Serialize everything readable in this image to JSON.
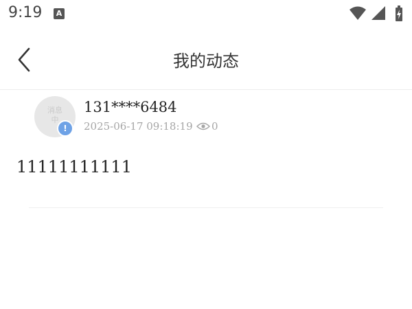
{
  "status_bar": {
    "time": "9:19",
    "notification_icon": "A"
  },
  "header": {
    "title": "我的动态"
  },
  "post": {
    "avatar_placeholder": "消息\n中",
    "username": "131****6484",
    "timestamp": "2025-06-17 09:18:19",
    "view_count": "0",
    "content": "11111111111"
  },
  "icons": [
    "back-arrow-icon",
    "eye-icon",
    "wifi-icon",
    "signal-icon",
    "battery-icon",
    "verified-badge-icon"
  ]
}
